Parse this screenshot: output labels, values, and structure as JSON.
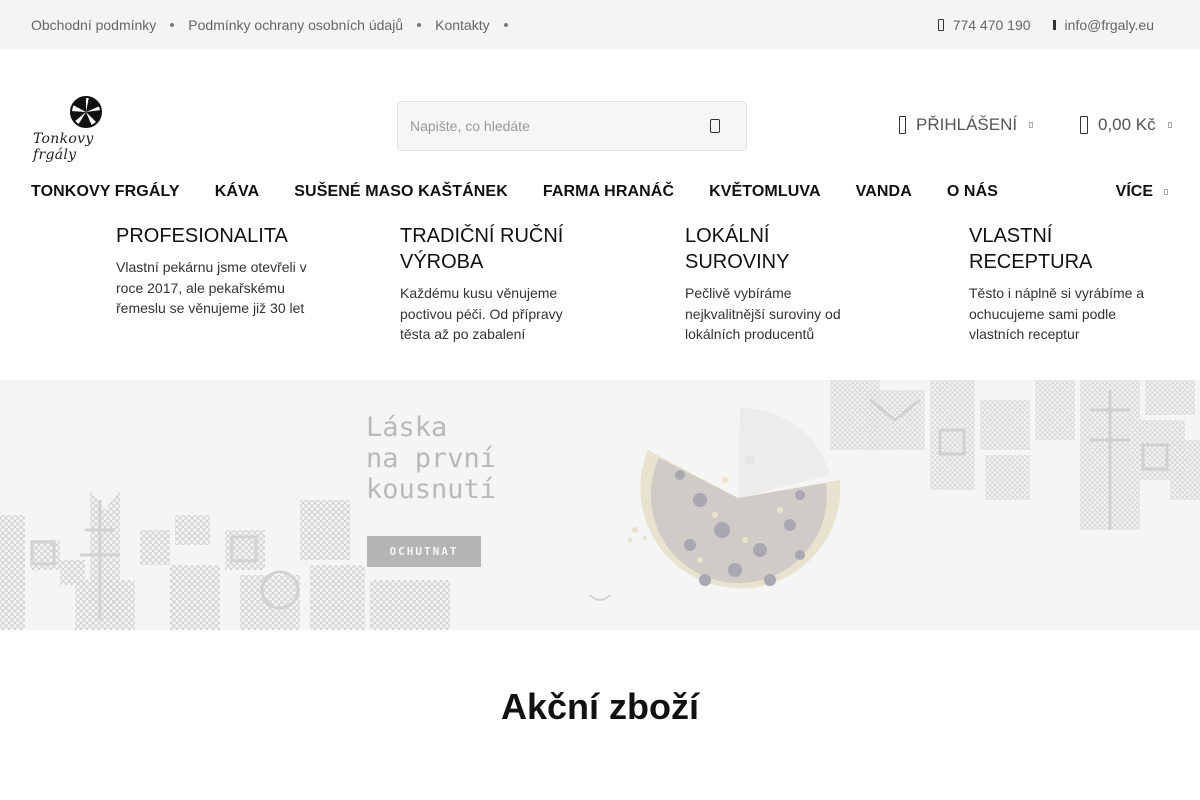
{
  "topbar": {
    "links": [
      "Obchodní podmínky",
      "Podmínky ochrany osobních údajů",
      "Kontakty"
    ],
    "phone": "774 470 190",
    "email": "info@frgaly.eu"
  },
  "header": {
    "logo_text": "Tonkovy frgály",
    "search_placeholder": "Napište, co hledáte",
    "login_label": "PŘIHLÁŠENÍ",
    "cart_total": "0,00 Kč"
  },
  "nav": {
    "items": [
      "TONKOVY FRGÁLY",
      "KÁVA",
      "SUŠENÉ MASO KAŠTÁNEK",
      "FARMA HRANÁČ",
      "KVĚTOMLUVA",
      "VANDA",
      "O NÁS"
    ],
    "more_label": "VÍCE"
  },
  "features": [
    {
      "title": "PROFESIONALITA",
      "text": "Vlastní pekárnu jsme otevřeli v roce 2017, ale pekařskému řemeslu se věnujeme již 30 let"
    },
    {
      "title": "TRADIČNÍ RUČNÍ VÝROBA",
      "text": "Každému kusu věnujeme poctivou péči. Od přípravy těsta až po zabalení"
    },
    {
      "title": "LOKÁLNÍ SUROVINY",
      "text": "Pečlivě vybíráme nejkvalitnější suroviny od lokálních producentů"
    },
    {
      "title": "VLASTNÍ RECEPTURA",
      "text": "Těsto i náplně si vyrábíme a ochucujeme sami podle vlastních receptur"
    }
  ],
  "banner": {
    "headline": "Láska\nna první\nkousnutí",
    "cta_label": "OCHUTNAT"
  },
  "sections": {
    "sale_title": "Akční zboží"
  },
  "colors": {
    "topbar_bg": "#f4f4f4",
    "banner_bg": "#f5f5f5",
    "text": "#111111",
    "muted": "#666666"
  },
  "icons": {
    "phone": "phone-icon",
    "email": "mail-icon",
    "search": "search-icon",
    "user": "user-icon",
    "cart": "cart-icon",
    "caret": "chevron-down-icon"
  }
}
